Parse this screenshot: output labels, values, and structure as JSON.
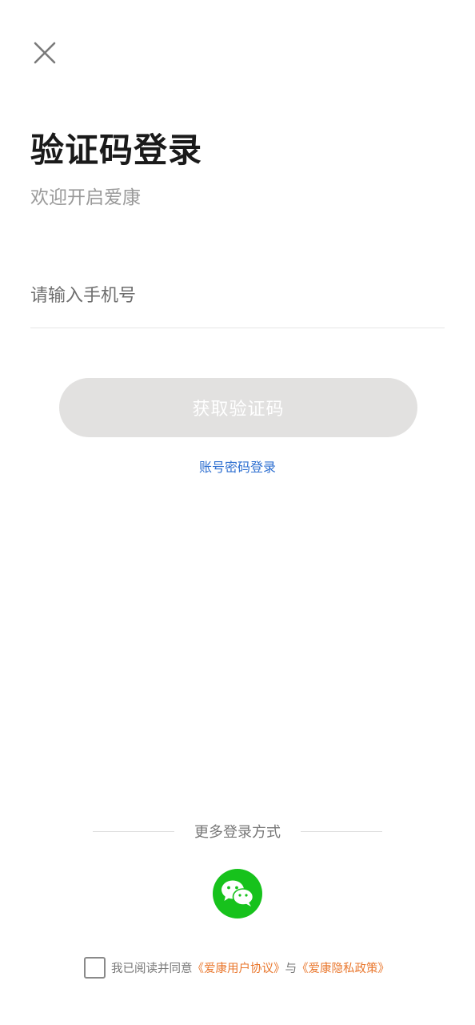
{
  "header": {
    "close_icon": "close-icon"
  },
  "main": {
    "title": "验证码登录",
    "subtitle": "欢迎开启爱康",
    "phone_placeholder": "请输入手机号",
    "get_code_label": "获取验证码",
    "password_login_link": "账号密码登录"
  },
  "footer": {
    "more_methods_label": "更多登录方式",
    "wechat_icon": "wechat-icon",
    "agreement": {
      "prefix": "我已阅读并同意",
      "user_agreement": "《爱康用户协议》",
      "conjunction": "与",
      "privacy_policy": "《爱康隐私政策》",
      "checked": false
    }
  },
  "colors": {
    "primary_text": "#1a1a1a",
    "secondary_text": "#9a9a9a",
    "button_disabled_bg": "#e2e1e0",
    "link_blue": "#2e6fd0",
    "link_orange": "#e9772d",
    "wechat_green": "#17c21c"
  }
}
